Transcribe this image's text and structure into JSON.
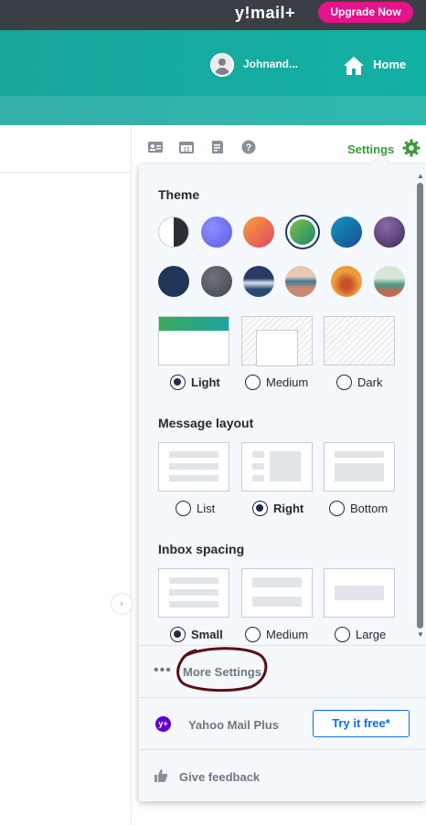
{
  "topbar": {
    "brand": "y!mail+",
    "upgrade_label": "Upgrade Now"
  },
  "header": {
    "username": "Johnand...",
    "home_label": "Home"
  },
  "toolbar": {
    "settings_label": "Settings"
  },
  "settings": {
    "theme_title": "Theme",
    "theme_swatches": [
      {
        "name": "theme-swatch-contrast",
        "color": "#ffffff"
      },
      {
        "name": "theme-swatch-violet",
        "color": "#6a6cf0"
      },
      {
        "name": "theme-swatch-sunset",
        "color": "#f07a4c"
      },
      {
        "name": "theme-swatch-green",
        "color": "#2fa45a"
      },
      {
        "name": "theme-swatch-blue",
        "color": "#1d6fb4"
      },
      {
        "name": "theme-swatch-purple",
        "color": "#4f3d73"
      },
      {
        "name": "theme-swatch-navy",
        "color": "#1f3658"
      },
      {
        "name": "theme-swatch-gray",
        "color": "#555a62"
      },
      {
        "name": "theme-swatch-wave",
        "color": "#2a3a62"
      },
      {
        "name": "theme-swatch-beach",
        "color": "#c98a70"
      },
      {
        "name": "theme-swatch-desert",
        "color": "#e8873a"
      },
      {
        "name": "theme-swatch-lighthouse",
        "color": "#4a9a8a"
      }
    ],
    "theme_modes": [
      {
        "label": "Light",
        "selected": true
      },
      {
        "label": "Medium",
        "selected": false
      },
      {
        "label": "Dark",
        "selected": false
      }
    ],
    "layout_title": "Message layout",
    "layout_options": [
      {
        "label": "List",
        "selected": false
      },
      {
        "label": "Right",
        "selected": true
      },
      {
        "label": "Bottom",
        "selected": false
      }
    ],
    "spacing_title": "Inbox spacing",
    "spacing_options": [
      {
        "label": "Small",
        "selected": true
      },
      {
        "label": "Medium",
        "selected": false
      },
      {
        "label": "Large",
        "selected": false
      }
    ],
    "more_settings": "More Settings",
    "mail_plus_label": "Yahoo Mail Plus",
    "try_label": "Try it free*",
    "feedback_label": "Give feedback",
    "plus_badge": "y+"
  },
  "colors": {
    "accent_teal": "#16a99f",
    "settings_green": "#3a9b3a",
    "upgrade_pink": "#e4148b",
    "link_blue": "#0f69ff",
    "annotation": "#5a0f14"
  }
}
